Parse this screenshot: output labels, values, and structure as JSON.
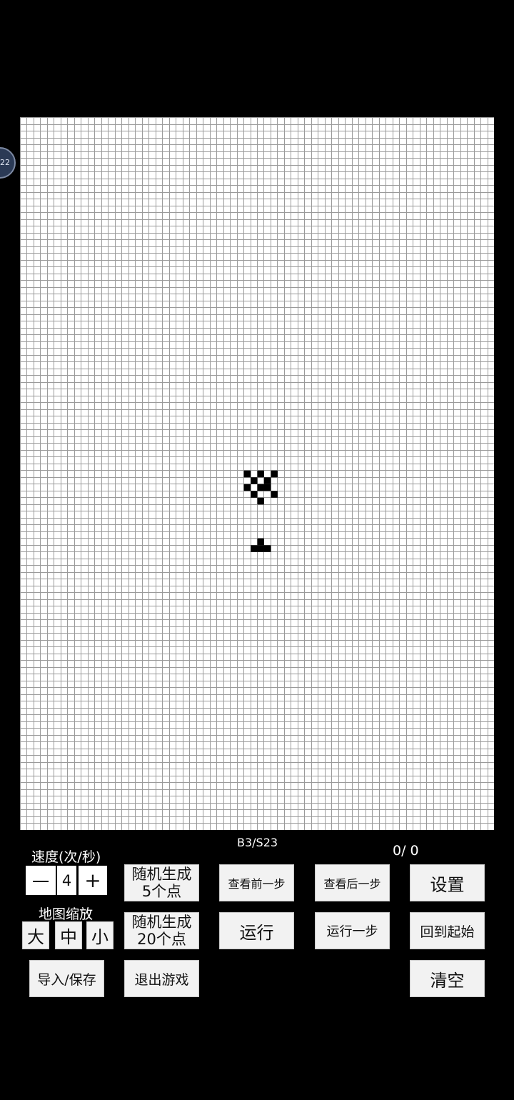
{
  "float_ball": {
    "text": "22",
    "icon": "floating-assist-icon"
  },
  "rule_label": "B3/S23",
  "generation_counter": "0/ 0",
  "speed": {
    "label": "速度(次/秒)",
    "minus_label": "一",
    "value": "4",
    "plus_label": "+"
  },
  "zoom": {
    "label": "地图缩放",
    "large_label": "大",
    "medium_label": "中",
    "small_label": "小"
  },
  "buttons": {
    "random5_line1": "随机生成",
    "random5_line2": "5个点",
    "random20_line1": "随机生成",
    "random20_line2": "20个点",
    "prev_step": "查看前一步",
    "next_step": "查看后一步",
    "run": "运行",
    "run_one_step": "运行一步",
    "settings": "设置",
    "back_to_start": "回到起始",
    "import_save": "导入/保存",
    "exit_game": "退出游戏",
    "clear": "清空"
  },
  "grid": {
    "cols": 70,
    "rows": 105,
    "line_color": "#9a9a9a",
    "cell_color": "#000000",
    "live_cells": [
      [
        33,
        52
      ],
      [
        35,
        52
      ],
      [
        37,
        52
      ],
      [
        34,
        53
      ],
      [
        36,
        53
      ],
      [
        33,
        54
      ],
      [
        35,
        54
      ],
      [
        36,
        54
      ],
      [
        34,
        55
      ],
      [
        37,
        55
      ],
      [
        35,
        56
      ],
      [
        35,
        62
      ],
      [
        34,
        63
      ],
      [
        35,
        63
      ],
      [
        36,
        63
      ]
    ]
  }
}
